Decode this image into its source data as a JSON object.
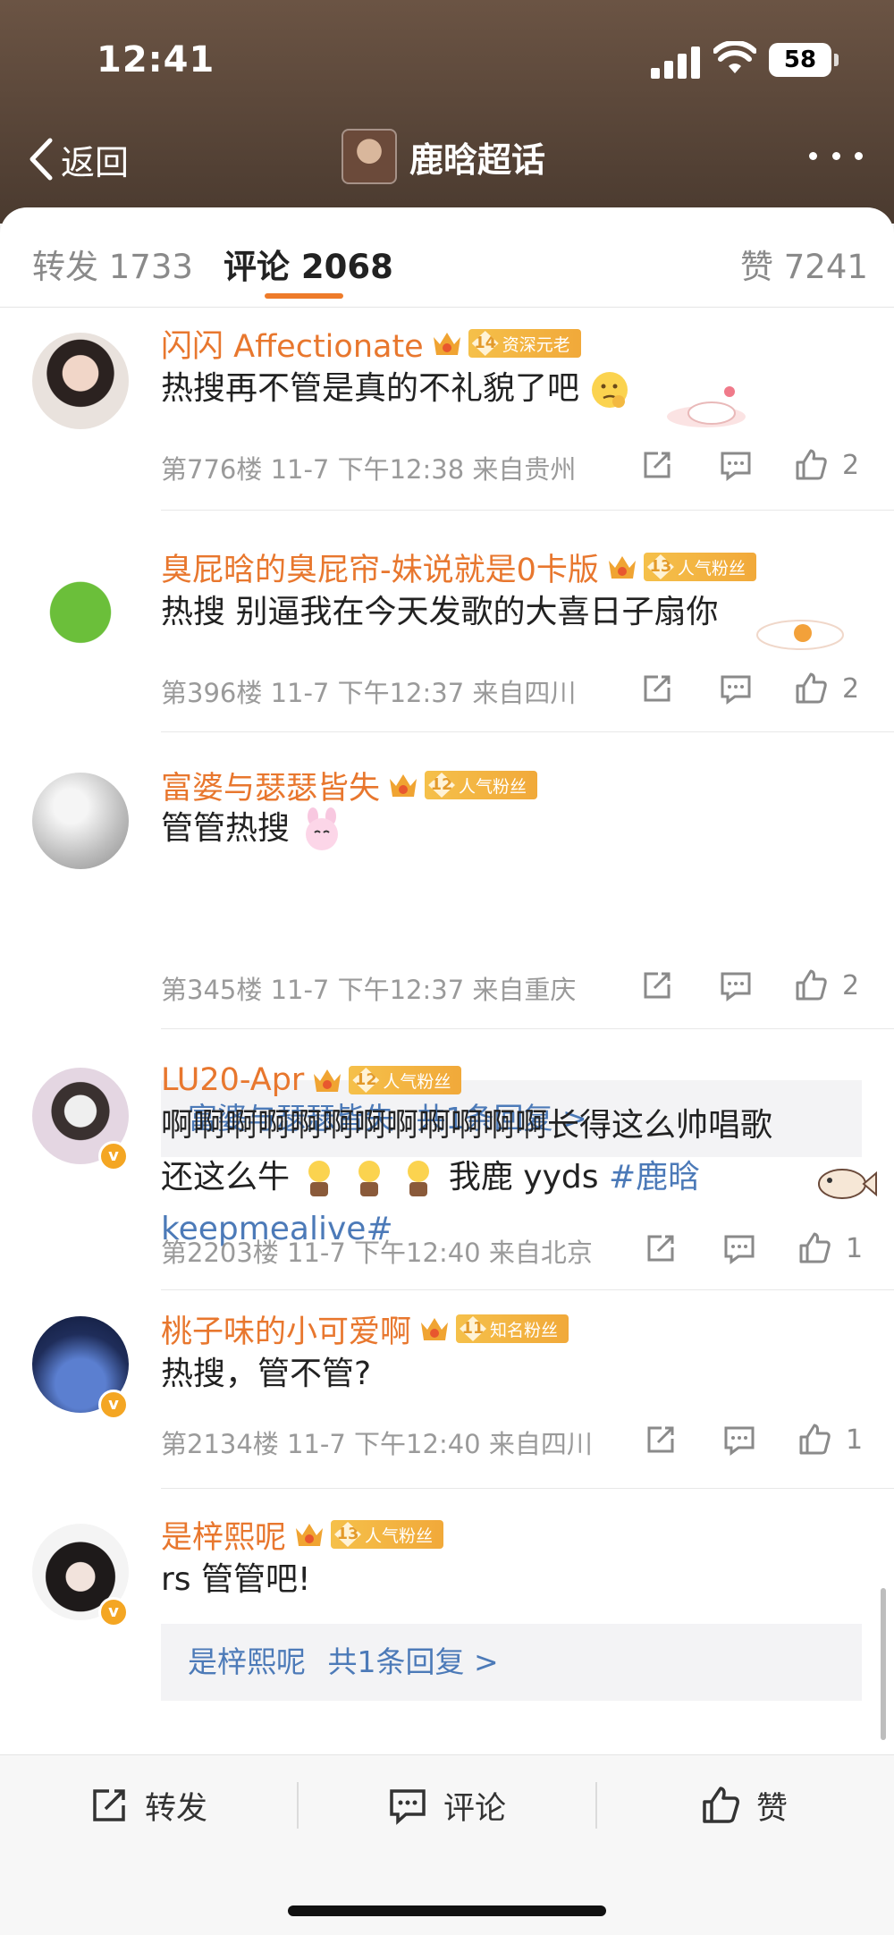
{
  "status": {
    "time": "12:41",
    "battery": "58"
  },
  "nav": {
    "back_label": "返回",
    "title": "鹿晗超话"
  },
  "tabs": [
    {
      "label": "转发 1733"
    },
    {
      "label": "评论 2068"
    },
    {
      "label": "赞 7241"
    }
  ],
  "comments": [
    {
      "username": "闪闪 Affectionate",
      "level": "14",
      "badge": "资深元老",
      "text": "热搜再不管是真的不礼貌了吧",
      "meta": "第776楼 11-7 下午12:38 来自贵州",
      "likes": "2"
    },
    {
      "username": "臭屁晗的臭屁帘-妹说就是0卡版",
      "level": "13",
      "badge": "人气粉丝",
      "text": "热搜 别逼我在今天发歌的大喜日子扇你",
      "meta": "第396楼 11-7 下午12:37 来自四川",
      "likes": "2"
    },
    {
      "username": "富婆与瑟瑟皆失",
      "level": "12",
      "badge": "人气粉丝",
      "text": "管管热搜",
      "reply_name": "富婆与瑟瑟皆失",
      "reply_count": "共1条回复 >",
      "meta": "第345楼 11-7 下午12:37 来自重庆",
      "likes": "2"
    },
    {
      "username": "LU20-Apr",
      "level": "12",
      "badge": "人气粉丝",
      "text_line1": "啊啊啊啊啊啊啊啊啊啊啊啊长得这么帅唱歌",
      "text_line2_a": "还这么牛",
      "text_line2_b": "我鹿 yyds",
      "hashtag_a": "#鹿晗",
      "hashtag_b": "keepmealive#",
      "meta": "第2203楼 11-7 下午12:40 来自北京",
      "likes": "1"
    },
    {
      "username": "桃子味的小可爱啊",
      "level": "11",
      "badge": "知名粉丝",
      "text": "热搜，管不管?",
      "meta": "第2134楼 11-7 下午12:40 来自四川",
      "likes": "1"
    },
    {
      "username": "是梓熙呢",
      "level": "13",
      "badge": "人气粉丝",
      "text": "rs 管管吧!",
      "reply_name": "是梓熙呢",
      "reply_count": "共1条回复 >"
    }
  ],
  "bottom": {
    "repost": "转发",
    "comment": "评论",
    "like": "赞"
  },
  "colors": {
    "username": "#e8772e",
    "link": "#4c7ab8",
    "header": "#5a4538",
    "tab_accent": "#ee7b2a"
  }
}
